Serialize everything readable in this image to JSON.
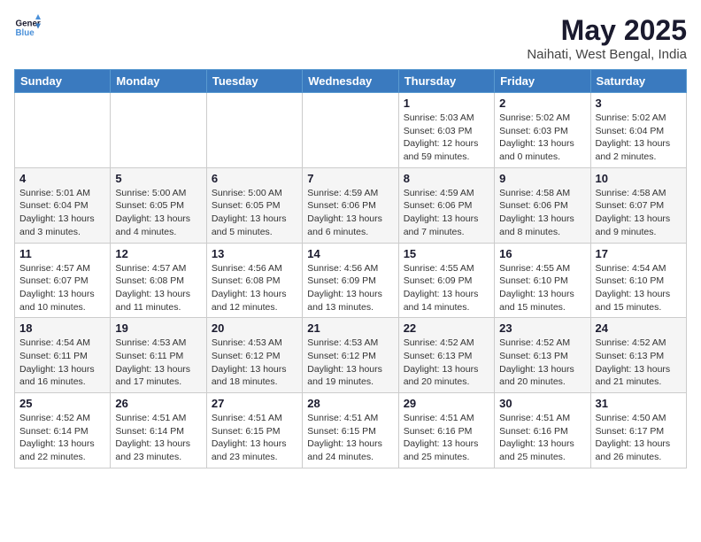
{
  "logo": {
    "line1": "General",
    "line2": "Blue"
  },
  "title": "May 2025",
  "subtitle": "Naihati, West Bengal, India",
  "days_header": [
    "Sunday",
    "Monday",
    "Tuesday",
    "Wednesday",
    "Thursday",
    "Friday",
    "Saturday"
  ],
  "weeks": [
    [
      {
        "day": "",
        "info": ""
      },
      {
        "day": "",
        "info": ""
      },
      {
        "day": "",
        "info": ""
      },
      {
        "day": "",
        "info": ""
      },
      {
        "day": "1",
        "info": "Sunrise: 5:03 AM\nSunset: 6:03 PM\nDaylight: 12 hours\nand 59 minutes."
      },
      {
        "day": "2",
        "info": "Sunrise: 5:02 AM\nSunset: 6:03 PM\nDaylight: 13 hours\nand 0 minutes."
      },
      {
        "day": "3",
        "info": "Sunrise: 5:02 AM\nSunset: 6:04 PM\nDaylight: 13 hours\nand 2 minutes."
      }
    ],
    [
      {
        "day": "4",
        "info": "Sunrise: 5:01 AM\nSunset: 6:04 PM\nDaylight: 13 hours\nand 3 minutes."
      },
      {
        "day": "5",
        "info": "Sunrise: 5:00 AM\nSunset: 6:05 PM\nDaylight: 13 hours\nand 4 minutes."
      },
      {
        "day": "6",
        "info": "Sunrise: 5:00 AM\nSunset: 6:05 PM\nDaylight: 13 hours\nand 5 minutes."
      },
      {
        "day": "7",
        "info": "Sunrise: 4:59 AM\nSunset: 6:06 PM\nDaylight: 13 hours\nand 6 minutes."
      },
      {
        "day": "8",
        "info": "Sunrise: 4:59 AM\nSunset: 6:06 PM\nDaylight: 13 hours\nand 7 minutes."
      },
      {
        "day": "9",
        "info": "Sunrise: 4:58 AM\nSunset: 6:06 PM\nDaylight: 13 hours\nand 8 minutes."
      },
      {
        "day": "10",
        "info": "Sunrise: 4:58 AM\nSunset: 6:07 PM\nDaylight: 13 hours\nand 9 minutes."
      }
    ],
    [
      {
        "day": "11",
        "info": "Sunrise: 4:57 AM\nSunset: 6:07 PM\nDaylight: 13 hours\nand 10 minutes."
      },
      {
        "day": "12",
        "info": "Sunrise: 4:57 AM\nSunset: 6:08 PM\nDaylight: 13 hours\nand 11 minutes."
      },
      {
        "day": "13",
        "info": "Sunrise: 4:56 AM\nSunset: 6:08 PM\nDaylight: 13 hours\nand 12 minutes."
      },
      {
        "day": "14",
        "info": "Sunrise: 4:56 AM\nSunset: 6:09 PM\nDaylight: 13 hours\nand 13 minutes."
      },
      {
        "day": "15",
        "info": "Sunrise: 4:55 AM\nSunset: 6:09 PM\nDaylight: 13 hours\nand 14 minutes."
      },
      {
        "day": "16",
        "info": "Sunrise: 4:55 AM\nSunset: 6:10 PM\nDaylight: 13 hours\nand 15 minutes."
      },
      {
        "day": "17",
        "info": "Sunrise: 4:54 AM\nSunset: 6:10 PM\nDaylight: 13 hours\nand 15 minutes."
      }
    ],
    [
      {
        "day": "18",
        "info": "Sunrise: 4:54 AM\nSunset: 6:11 PM\nDaylight: 13 hours\nand 16 minutes."
      },
      {
        "day": "19",
        "info": "Sunrise: 4:53 AM\nSunset: 6:11 PM\nDaylight: 13 hours\nand 17 minutes."
      },
      {
        "day": "20",
        "info": "Sunrise: 4:53 AM\nSunset: 6:12 PM\nDaylight: 13 hours\nand 18 minutes."
      },
      {
        "day": "21",
        "info": "Sunrise: 4:53 AM\nSunset: 6:12 PM\nDaylight: 13 hours\nand 19 minutes."
      },
      {
        "day": "22",
        "info": "Sunrise: 4:52 AM\nSunset: 6:13 PM\nDaylight: 13 hours\nand 20 minutes."
      },
      {
        "day": "23",
        "info": "Sunrise: 4:52 AM\nSunset: 6:13 PM\nDaylight: 13 hours\nand 20 minutes."
      },
      {
        "day": "24",
        "info": "Sunrise: 4:52 AM\nSunset: 6:13 PM\nDaylight: 13 hours\nand 21 minutes."
      }
    ],
    [
      {
        "day": "25",
        "info": "Sunrise: 4:52 AM\nSunset: 6:14 PM\nDaylight: 13 hours\nand 22 minutes."
      },
      {
        "day": "26",
        "info": "Sunrise: 4:51 AM\nSunset: 6:14 PM\nDaylight: 13 hours\nand 23 minutes."
      },
      {
        "day": "27",
        "info": "Sunrise: 4:51 AM\nSunset: 6:15 PM\nDaylight: 13 hours\nand 23 minutes."
      },
      {
        "day": "28",
        "info": "Sunrise: 4:51 AM\nSunset: 6:15 PM\nDaylight: 13 hours\nand 24 minutes."
      },
      {
        "day": "29",
        "info": "Sunrise: 4:51 AM\nSunset: 6:16 PM\nDaylight: 13 hours\nand 25 minutes."
      },
      {
        "day": "30",
        "info": "Sunrise: 4:51 AM\nSunset: 6:16 PM\nDaylight: 13 hours\nand 25 minutes."
      },
      {
        "day": "31",
        "info": "Sunrise: 4:50 AM\nSunset: 6:17 PM\nDaylight: 13 hours\nand 26 minutes."
      }
    ]
  ]
}
